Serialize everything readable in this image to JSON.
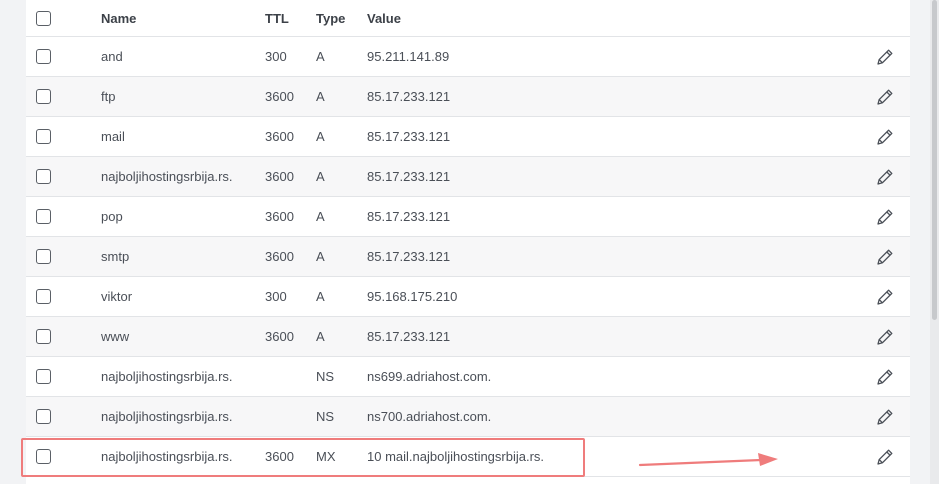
{
  "table": {
    "headers": {
      "name": "Name",
      "ttl": "TTL",
      "type": "Type",
      "value": "Value"
    },
    "rows": [
      {
        "name": "and",
        "ttl": "300",
        "type": "A",
        "value": "95.211.141.89"
      },
      {
        "name": "ftp",
        "ttl": "3600",
        "type": "A",
        "value": "85.17.233.121"
      },
      {
        "name": "mail",
        "ttl": "3600",
        "type": "A",
        "value": "85.17.233.121"
      },
      {
        "name": "najboljihostingsrbija.rs.",
        "ttl": "3600",
        "type": "A",
        "value": "85.17.233.121"
      },
      {
        "name": "pop",
        "ttl": "3600",
        "type": "A",
        "value": "85.17.233.121"
      },
      {
        "name": "smtp",
        "ttl": "3600",
        "type": "A",
        "value": "85.17.233.121"
      },
      {
        "name": "viktor",
        "ttl": "300",
        "type": "A",
        "value": "95.168.175.210"
      },
      {
        "name": "www",
        "ttl": "3600",
        "type": "A",
        "value": "85.17.233.121"
      },
      {
        "name": "najboljihostingsrbija.rs.",
        "ttl": "",
        "type": "NS",
        "value": "ns699.adriahost.com."
      },
      {
        "name": "najboljihostingsrbija.rs.",
        "ttl": "",
        "type": "NS",
        "value": "ns700.adriahost.com."
      },
      {
        "name": "najboljihostingsrbija.rs.",
        "ttl": "3600",
        "type": "MX",
        "value": "10 mail.najboljihostingsrbija.rs."
      }
    ]
  },
  "icons": {
    "edit": "pencil-icon",
    "select": "checkbox"
  },
  "colors": {
    "highlight": "#ef7c7c",
    "row_alt": "#f7f7f8",
    "border": "#e2e4e7"
  }
}
